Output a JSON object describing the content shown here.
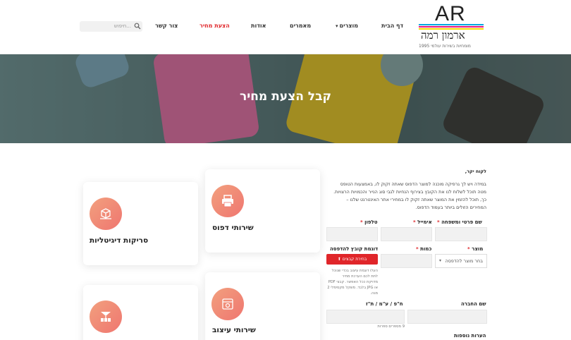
{
  "logo": {
    "initials": "AR",
    "name": "ארמון רמה",
    "tagline": "מומחיות בשירות עולמי 1995",
    "bar_colors": [
      "#00a8e0",
      "#e5197d",
      "#f5d900",
      "#111111"
    ]
  },
  "nav": {
    "home": "דף הבית",
    "products": "מוצרים",
    "articles": "מאמרים",
    "about": "אודות",
    "quote": "הצעת מחיר",
    "contact": "צור קשר"
  },
  "search": {
    "placeholder": "חיפוש..."
  },
  "hero": {
    "title": "קבל הצעת מחיר"
  },
  "services": {
    "print": "שירותי דפוס",
    "scan": "סריקות דיגיטליות",
    "design": "שירותי עיצוב",
    "production": ""
  },
  "form": {
    "greeting": "לקוח יקר,",
    "intro_1": "במידה ויש לך גרפיקה מוכנה למוצר הדפוס שאתה זקוק לו, באמצעות הטופס",
    "intro_2": "מטה תוכל לשלוח לנו את הקובץ בצירוף הנחיות לגבי סוג הנייר והכמויות הרצויות.",
    "intro_3": "כך, תוכל להזמין את המוצר שאתה זקוק לו במחירי אתר האינטרנט שלנו –",
    "intro_4": "המחירים הזולים ביותר בעמוד הדפוס.",
    "fullname_label": "שם פרטי ומשפחה",
    "email_label": "אימייל",
    "phone_label": "טלפון",
    "product_label": "מוצר",
    "product_select": "בחר מוצר להדפסה",
    "quantity_label": "כמות",
    "file_label": "דוגמת קובץ להדפסה",
    "upload_button": "בחירת קבצים",
    "upload_note_1": "העלו דוגמת עיצוב בכדי שנוכל",
    "upload_note_2": "לתת לכם הערכת מחיר",
    "upload_note_3": "מדויקת ככל האפשר. קבצי PDF",
    "upload_note_4": "או JPG בלבד. משקל מקסימלי 2",
    "upload_note_5": "מגה.",
    "company_label": "שם החברה",
    "tax_label": "ח\"פ / ע\"מ / ת\"ז",
    "tax_note": "9 מספרים ספרות",
    "notes_label": "הערות נוספות"
  },
  "colors": {
    "accent": "#e0262a",
    "icon_gradient_start": "#f2a07e",
    "icon_gradient_end": "#ef7670"
  }
}
